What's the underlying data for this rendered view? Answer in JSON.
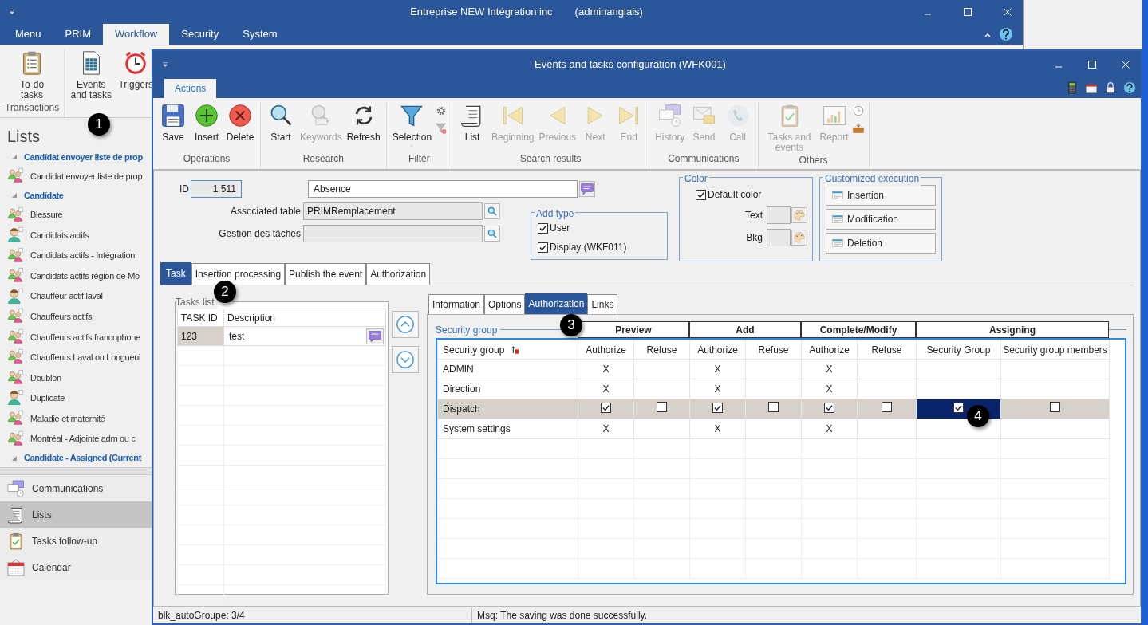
{
  "main_window": {
    "title": "Entreprise NEW Intégration inc",
    "user": "(adminanglais)",
    "tabs": [
      {
        "label": "Menu",
        "selected": false
      },
      {
        "label": "PRIM",
        "selected": false
      },
      {
        "label": "Workflow",
        "selected": true
      },
      {
        "label": "Security",
        "selected": false
      },
      {
        "label": "System",
        "selected": false
      }
    ],
    "ribbon": [
      {
        "group": "Transactions",
        "buttons": [
          {
            "label": "To-do tasks",
            "kind": "clipboard"
          }
        ]
      },
      {
        "buttons": [
          {
            "label": "Events and tasks",
            "kind": "sheet"
          },
          {
            "label": "Triggers",
            "kind": "alarm"
          }
        ]
      }
    ]
  },
  "lists_panel": {
    "title": "Lists",
    "items": [
      {
        "kind": "header",
        "label": "Candidat envoyer liste de prop"
      },
      {
        "kind": "people",
        "label": "Candidat envoyer liste de prop"
      },
      {
        "kind": "header",
        "label": "Candidate"
      },
      {
        "kind": "people",
        "label": "Blessure"
      },
      {
        "kind": "person",
        "label": "Candidats actifs"
      },
      {
        "kind": "people",
        "label": "Candidats actifs - Intégration"
      },
      {
        "kind": "people",
        "label": "Candidats actifs région de Mo"
      },
      {
        "kind": "person",
        "label": "Chauffeur actif laval"
      },
      {
        "kind": "people",
        "label": "Chauffeurs actifs"
      },
      {
        "kind": "people",
        "label": "Chauffeurs actifs francophone"
      },
      {
        "kind": "people",
        "label": "Chauffeurs Laval ou Longueui"
      },
      {
        "kind": "people",
        "label": "Doublon"
      },
      {
        "kind": "person",
        "label": "Duplicate"
      },
      {
        "kind": "people",
        "label": "Maladie et maternité"
      },
      {
        "kind": "people",
        "label": "Montréal - Adjointe adm ou c"
      },
      {
        "kind": "header",
        "label": "Candidate - Assigned (Current"
      }
    ],
    "nav": [
      {
        "label": "Communications",
        "kind": "chat-clock",
        "selected": false
      },
      {
        "label": "Lists",
        "kind": "scroll",
        "selected": true
      },
      {
        "label": "Tasks follow-up",
        "kind": "clipboard-check",
        "selected": false
      },
      {
        "label": "Calendar",
        "kind": "calendar",
        "selected": false
      }
    ]
  },
  "dialog": {
    "title": "Events and tasks configuration (WFK001)",
    "tabs": [
      {
        "label": "Actions",
        "selected": true
      }
    ],
    "ribbon": [
      {
        "group": "Operations",
        "buttons": [
          {
            "label": "Save",
            "kind": "floppy",
            "disabled": false
          },
          {
            "label": "Insert",
            "kind": "plus",
            "disabled": false
          },
          {
            "label": "Delete",
            "kind": "xcircle",
            "disabled": false
          }
        ]
      },
      {
        "group": "Research",
        "buttons": [
          {
            "label": "Start",
            "kind": "magnifier",
            "disabled": false
          },
          {
            "label": "Keywords",
            "kind": "magnifier-abc",
            "disabled": true
          },
          {
            "label": "Refresh",
            "kind": "refresh",
            "disabled": false
          }
        ]
      },
      {
        "group": "Filter",
        "buttons": [
          {
            "label": "Selection",
            "kind": "funnel",
            "disabled": false,
            "dropdown": true
          }
        ],
        "small_buttons": [
          {
            "kind": "gear"
          },
          {
            "kind": "funnel-remove"
          }
        ]
      },
      {
        "group": "Search results",
        "buttons": [
          {
            "label": "List",
            "kind": "scroll",
            "disabled": false
          },
          {
            "label": "Beginning",
            "kind": "first",
            "disabled": true
          },
          {
            "label": "Previous",
            "kind": "prev",
            "disabled": true
          },
          {
            "label": "Next",
            "kind": "next",
            "disabled": true
          },
          {
            "label": "End",
            "kind": "last",
            "disabled": true
          }
        ]
      },
      {
        "group": "Communications",
        "buttons": [
          {
            "label": "History",
            "kind": "chat-clock",
            "disabled": true
          },
          {
            "label": "Send",
            "kind": "envelope",
            "disabled": true
          },
          {
            "label": "Call",
            "kind": "phone",
            "disabled": true
          }
        ]
      },
      {
        "group": "Others",
        "buttons": [
          {
            "label": "Tasks and events",
            "kind": "clipboard-check",
            "disabled": true
          },
          {
            "label": "Report",
            "kind": "chart",
            "disabled": true
          }
        ],
        "small_buttons": [
          {
            "kind": "clock"
          },
          {
            "kind": "tray"
          }
        ]
      }
    ],
    "form": {
      "id_label": "ID",
      "id_value": "1 511",
      "name_value": "Absence",
      "associated_table": {
        "label": "Associated table",
        "value": "PRIMRemplacement"
      },
      "task_management": {
        "label": "Gestion des tâches"
      },
      "add_type": {
        "title": "Add type",
        "options": [
          {
            "label": "User",
            "checked": true
          },
          {
            "label": "Display (WKF011)",
            "checked": true
          }
        ]
      },
      "color": {
        "title": "Color",
        "default_color": {
          "label": "Default color",
          "checked": true
        },
        "text_label": "Text",
        "bkg_label": "Bkg"
      },
      "customized_execution": {
        "title": "Customized execution",
        "buttons": [
          "Insertion",
          "Modification",
          "Deletion"
        ]
      }
    },
    "tabs_lower": [
      {
        "label": "Task",
        "selected": true
      },
      {
        "label": "Insertion processing",
        "selected": false
      },
      {
        "label": "Publish the event",
        "selected": false
      },
      {
        "label": "Authorization",
        "selected": false
      }
    ],
    "tasks_list": {
      "title": "Tasks list",
      "columns": [
        "TASK ID",
        "Description"
      ],
      "rows": [
        {
          "id": "123",
          "description": "test",
          "selected": true
        }
      ]
    },
    "detail_tabs": [
      {
        "label": "Information",
        "selected": false
      },
      {
        "label": "Options",
        "selected": false
      },
      {
        "label": "Authorization",
        "selected": true
      },
      {
        "label": "Links",
        "selected": false
      }
    ],
    "authorization": {
      "title": "Security group",
      "column_groups": [
        "Preview",
        "Add",
        "Complete/Modify",
        "Assigning"
      ],
      "columns": [
        "Security group",
        "Authorize",
        "Refuse",
        "Authorize",
        "Refuse",
        "Authorize",
        "Refuse",
        "Security Group",
        "Security group members"
      ],
      "rows": [
        {
          "name": "ADMIN",
          "selected": false,
          "cells": [
            {
              "kind": "text",
              "text": "X"
            },
            {
              "kind": "empty"
            },
            {
              "kind": "text",
              "text": "X"
            },
            {
              "kind": "empty"
            },
            {
              "kind": "text",
              "text": "X"
            },
            {
              "kind": "empty"
            },
            {
              "kind": "empty"
            },
            {
              "kind": "empty"
            }
          ]
        },
        {
          "name": "Direction",
          "selected": false,
          "cells": [
            {
              "kind": "text",
              "text": "X"
            },
            {
              "kind": "empty"
            },
            {
              "kind": "text",
              "text": "X"
            },
            {
              "kind": "empty"
            },
            {
              "kind": "text",
              "text": "X"
            },
            {
              "kind": "empty"
            },
            {
              "kind": "empty"
            },
            {
              "kind": "empty"
            }
          ]
        },
        {
          "name": "Dispatch",
          "selected": true,
          "cells": [
            {
              "kind": "checkbox",
              "checked": true,
              "focused": false
            },
            {
              "kind": "checkbox",
              "checked": false,
              "focused": false
            },
            {
              "kind": "checkbox",
              "checked": true,
              "focused": false
            },
            {
              "kind": "checkbox",
              "checked": false,
              "focused": false
            },
            {
              "kind": "checkbox",
              "checked": true,
              "focused": false
            },
            {
              "kind": "checkbox",
              "checked": false,
              "focused": false
            },
            {
              "kind": "checkbox",
              "checked": true,
              "focused": true
            },
            {
              "kind": "checkbox",
              "checked": false,
              "focused": false
            }
          ]
        },
        {
          "name": "System settings",
          "selected": false,
          "cells": [
            {
              "kind": "text",
              "text": "X"
            },
            {
              "kind": "empty"
            },
            {
              "kind": "text",
              "text": "X"
            },
            {
              "kind": "empty"
            },
            {
              "kind": "text",
              "text": "X"
            },
            {
              "kind": "empty"
            },
            {
              "kind": "empty"
            },
            {
              "kind": "empty"
            }
          ]
        }
      ]
    }
  },
  "status_bar": {
    "block": "blk_autoGroupe: 3/4",
    "message": "Msq: The saving was done successfully."
  },
  "callouts": [
    "1",
    "2",
    "3",
    "4"
  ]
}
